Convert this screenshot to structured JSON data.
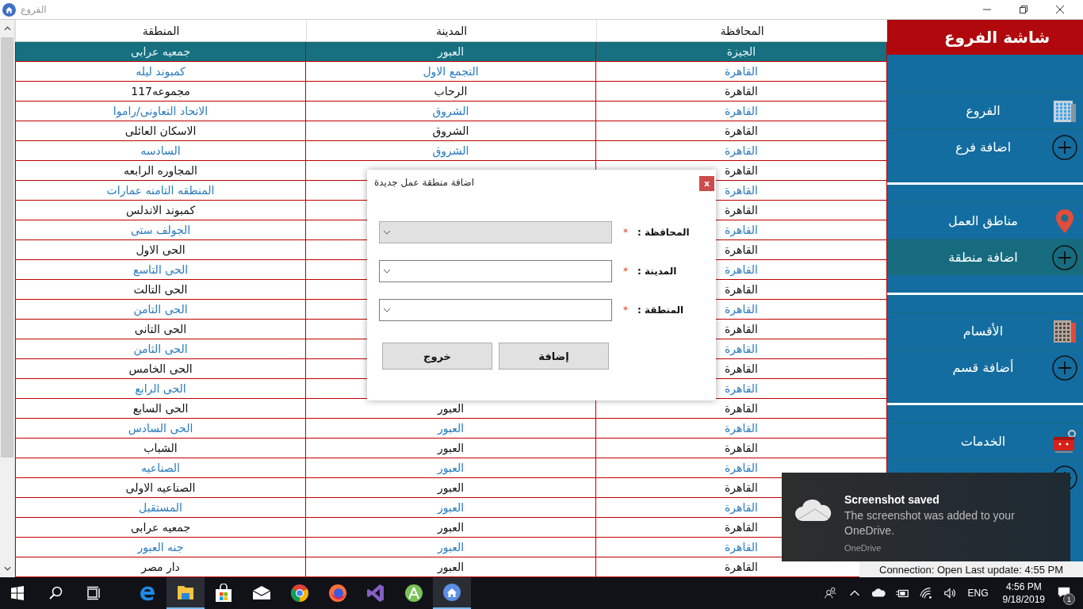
{
  "window": {
    "title": "الفروع"
  },
  "table": {
    "columns": [
      "المحافظة",
      "المدينة",
      "المنطقة"
    ],
    "rows": [
      {
        "cells": [
          "الجيزة",
          "العبور",
          "جمعيه عرابى"
        ],
        "selected": true
      },
      {
        "cells": [
          "القاهرة",
          "التجمع الاول",
          "كمبوند ليله"
        ],
        "selected": false
      },
      {
        "cells": [
          "القاهرة",
          "الرحاب",
          "مجموعه117"
        ],
        "selected": false
      },
      {
        "cells": [
          "القاهرة",
          "الشروق",
          "الاتحاد التعاونى/راموا"
        ],
        "selected": false
      },
      {
        "cells": [
          "القاهرة",
          "الشروق",
          "الاسكان العائلى"
        ],
        "selected": false
      },
      {
        "cells": [
          "القاهرة",
          "الشروق",
          "السادسه"
        ],
        "selected": false
      },
      {
        "cells": [
          "القاهرة",
          null,
          "المجاوره الرابعه"
        ],
        "selected": false
      },
      {
        "cells": [
          "القاهرة",
          null,
          "المنطقه التامنه عمارات"
        ],
        "selected": false
      },
      {
        "cells": [
          "القاهرة",
          null,
          "كمبوند الاندلس"
        ],
        "selected": false
      },
      {
        "cells": [
          "القاهرة",
          null,
          "الجولف ستى"
        ],
        "selected": false
      },
      {
        "cells": [
          "القاهرة",
          null,
          "الحى الاول"
        ],
        "selected": false
      },
      {
        "cells": [
          "القاهرة",
          null,
          "الحى التاسع"
        ],
        "selected": false
      },
      {
        "cells": [
          "القاهرة",
          null,
          "الحى التالت"
        ],
        "selected": false
      },
      {
        "cells": [
          "القاهرة",
          null,
          "الحى التامن"
        ],
        "selected": false
      },
      {
        "cells": [
          "القاهرة",
          null,
          "الحى التانى"
        ],
        "selected": false
      },
      {
        "cells": [
          "القاهرة",
          null,
          "الحى الثامن"
        ],
        "selected": false
      },
      {
        "cells": [
          "القاهرة",
          null,
          "الحى الخامس"
        ],
        "selected": false
      },
      {
        "cells": [
          "القاهرة",
          null,
          "الحى الرابع"
        ],
        "selected": false
      },
      {
        "cells": [
          "القاهرة",
          "العبور",
          "الحى السابع"
        ],
        "selected": false
      },
      {
        "cells": [
          "القاهرة",
          "العبور",
          "الحى السادس"
        ],
        "selected": false
      },
      {
        "cells": [
          "القاهرة",
          "العبور",
          "الشباب"
        ],
        "selected": false
      },
      {
        "cells": [
          "القاهرة",
          "العبور",
          "الصناعيه"
        ],
        "selected": false
      },
      {
        "cells": [
          "القاهرة",
          "العبور",
          "الصناعيه الاولى"
        ],
        "selected": false
      },
      {
        "cells": [
          "القاهرة",
          "العبور",
          "المستقبل"
        ],
        "selected": false
      },
      {
        "cells": [
          "القاهرة",
          "العبور",
          "جمعيه عرابى"
        ],
        "selected": false
      },
      {
        "cells": [
          "القاهرة",
          "العبور",
          "جنه العبور"
        ],
        "selected": false
      },
      {
        "cells": [
          "القاهرة",
          "العبور",
          "دار مصر"
        ],
        "selected": false
      }
    ]
  },
  "sidebar": {
    "title": "شاشة الفروع",
    "groups": [
      {
        "items": [
          {
            "kind": "main",
            "label": "الفروع",
            "selected": false
          },
          {
            "kind": "add",
            "label": "اضافة فرع",
            "selected": false
          }
        ]
      },
      {
        "items": [
          {
            "kind": "main",
            "label": "مناطق العمل",
            "selected": false
          },
          {
            "kind": "add",
            "label": "اضافة منطقة",
            "selected": true
          }
        ]
      },
      {
        "items": [
          {
            "kind": "main",
            "label": "الأقسام",
            "selected": false
          },
          {
            "kind": "add",
            "label": "أضافة قسم",
            "selected": false
          }
        ]
      },
      {
        "items": [
          {
            "kind": "main",
            "label": "الخدمات",
            "selected": false
          },
          {
            "kind": "add",
            "selected": false
          }
        ]
      }
    ]
  },
  "status_bar": "Connection: Open Last update: 4:55 PM",
  "dialog": {
    "title": "اضافة منطقة عمل جديدة",
    "close": "x",
    "fields": [
      {
        "label": "المحافظة :",
        "required_mark": "*",
        "disabled": true
      },
      {
        "label": "المدينة :",
        "required_mark": "*",
        "disabled": false
      },
      {
        "label": "المنطقة :",
        "required_mark": "*",
        "disabled": false
      }
    ],
    "buttons": [
      "إضافة",
      "خروج"
    ]
  },
  "notification": {
    "title": "Screenshot saved",
    "body": "The screenshot was added to your OneDrive.",
    "source": "OneDrive"
  },
  "taskbar": {
    "apps": [
      {
        "kind": "web",
        "active": false
      },
      {
        "kind": "files",
        "active": true
      },
      {
        "kind": "store",
        "active": false
      },
      {
        "kind": "mail",
        "active": false
      },
      {
        "kind": "chrome",
        "active": false
      },
      {
        "kind": "firefox",
        "active": false
      },
      {
        "kind": "ide",
        "active": false
      },
      {
        "kind": "android",
        "active": false
      },
      {
        "kind": "home",
        "active": true
      }
    ],
    "language": "ENG",
    "time": "4:56 PM",
    "date": "9/18/2019",
    "notification_count": "1"
  }
}
